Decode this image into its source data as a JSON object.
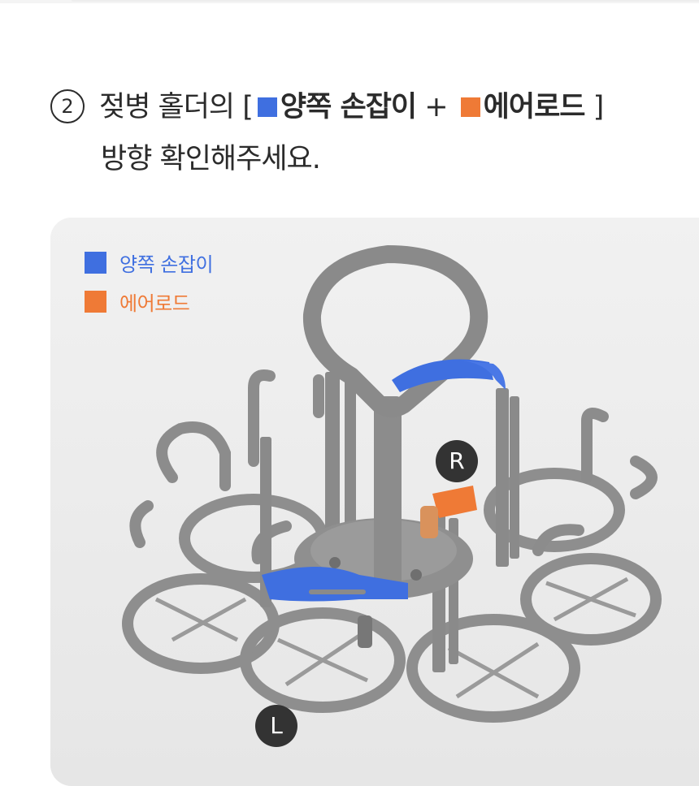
{
  "step": {
    "number": "2",
    "line1_prefix": "젖병 홀더의 [",
    "handles_label": "양쪽 손잡이",
    "plus": " + ",
    "airrod_label": "에어로드",
    "line1_suffix": " ]",
    "line2": "방향 확인해주세요."
  },
  "legend": {
    "handles": "양쪽 손잡이",
    "airrod": "에어로드"
  },
  "markers": {
    "right": "R",
    "left": "L"
  },
  "colors": {
    "handles": "#3f6fe0",
    "airrod": "#ef7a36",
    "holder_body": "#8c8c8c",
    "panel_bg": "#eeeeee"
  }
}
